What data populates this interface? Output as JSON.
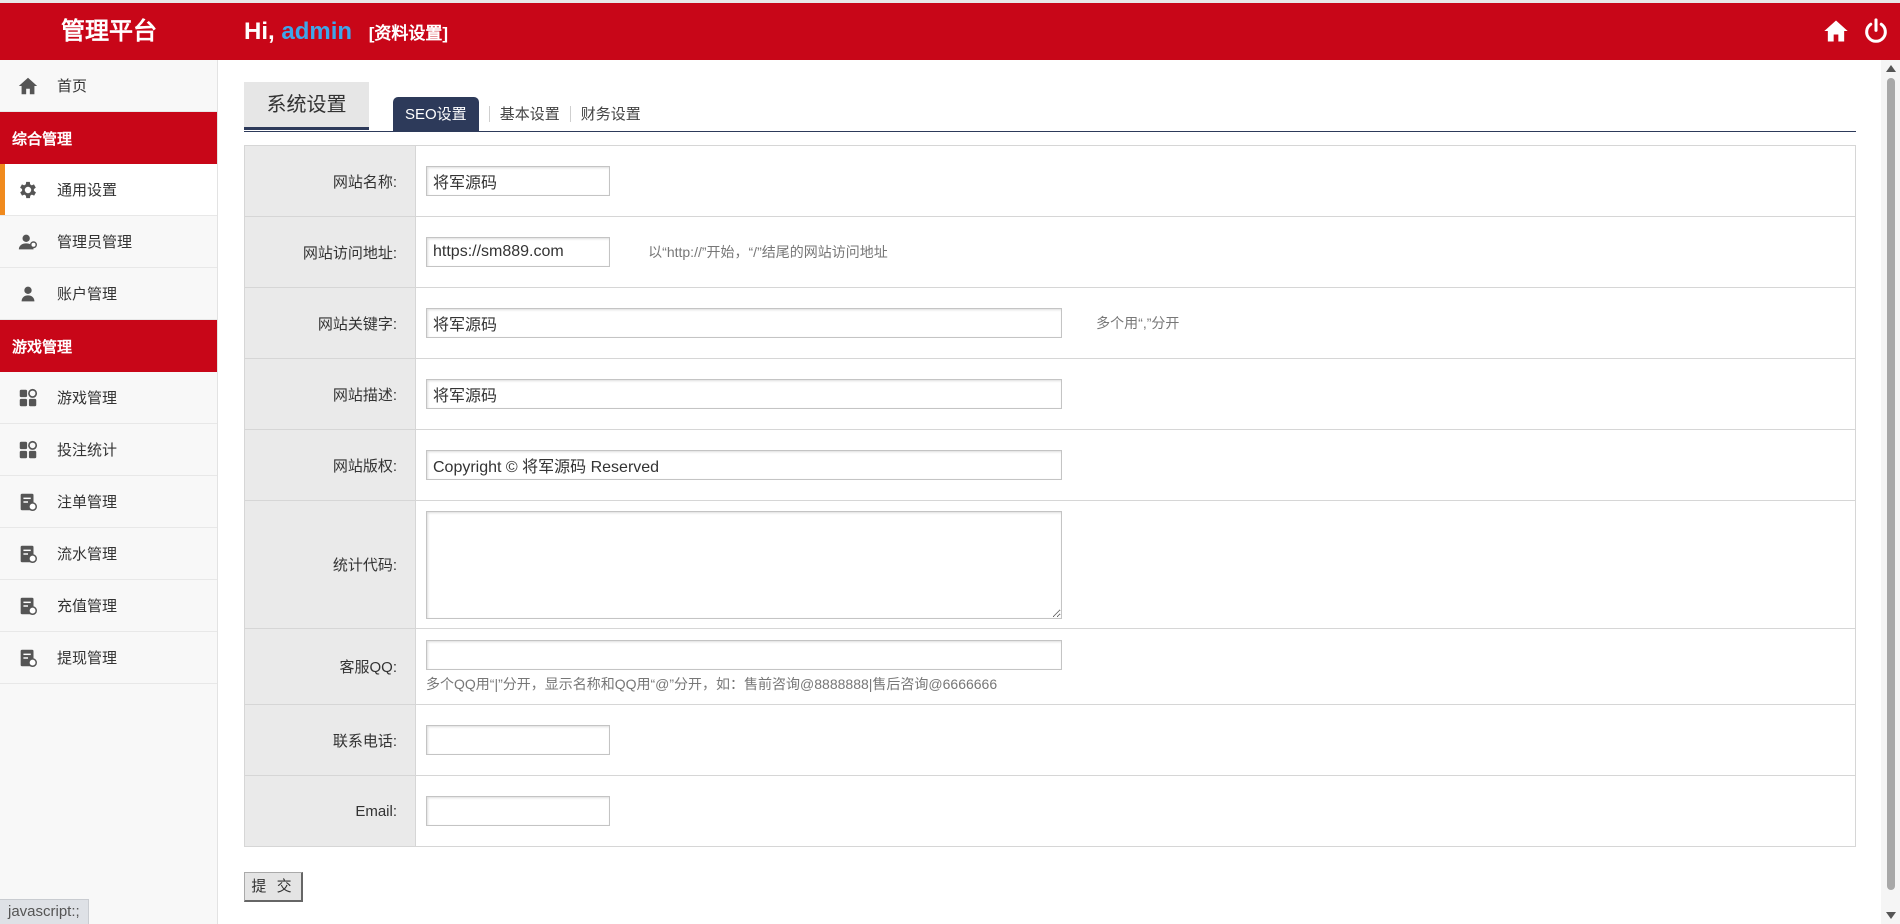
{
  "header": {
    "logo": "管理平台",
    "greeting": "Hi,",
    "username": "admin",
    "page_label": "[资料设置]",
    "icons": [
      "home-icon",
      "power-icon"
    ]
  },
  "sidebar": {
    "home": {
      "label": "首页",
      "icon": "home-icon"
    },
    "groups": [
      {
        "title": "综合管理",
        "items": [
          {
            "label": "通用设置",
            "icon": "gear-icon",
            "active": true
          },
          {
            "label": "管理员管理",
            "icon": "users-icon"
          },
          {
            "label": "账户管理",
            "icon": "user-icon"
          }
        ]
      },
      {
        "title": "游戏管理",
        "items": [
          {
            "label": "游戏管理",
            "icon": "apps-icon"
          },
          {
            "label": "投注统计",
            "icon": "apps-icon"
          },
          {
            "label": "注单管理",
            "icon": "doc-icon"
          },
          {
            "label": "流水管理",
            "icon": "doc-icon"
          },
          {
            "label": "充值管理",
            "icon": "doc-icon"
          },
          {
            "label": "提现管理",
            "icon": "doc-icon"
          }
        ]
      }
    ]
  },
  "main": {
    "section_title": "系统设置",
    "tabs": [
      {
        "label": "SEO设置",
        "active": true
      },
      {
        "label": "基本设置"
      },
      {
        "label": "财务设置"
      }
    ],
    "fields": {
      "site_name": {
        "label": "网站名称:",
        "value": "将军源码"
      },
      "site_url": {
        "label": "网站访问地址:",
        "value": "https://sm889.com",
        "hint": "以“http://”开始，“/”结尾的网站访问地址"
      },
      "keywords": {
        "label": "网站关键字:",
        "value": "将军源码",
        "hint": "多个用“,”分开"
      },
      "description": {
        "label": "网站描述:",
        "value": "将军源码"
      },
      "copyright": {
        "label": "网站版权:",
        "value": "Copyright © 将军源码 Reserved"
      },
      "stats_code": {
        "label": "统计代码:",
        "value": ""
      },
      "qq": {
        "label": "客服QQ:",
        "value": "",
        "hint": "多个QQ用“|”分开，显示名称和QQ用“@”分开，如：售前咨询@8888888|售后咨询@6666666"
      },
      "phone": {
        "label": "联系电话:",
        "value": ""
      },
      "email": {
        "label": "Email:",
        "value": ""
      }
    },
    "submit_label": "提 交"
  },
  "statusbar": {
    "text": "javascript:;"
  },
  "colors": {
    "brand": "#c80618",
    "accent_tab": "#2d3a5a",
    "active_marker": "#f08a1d",
    "username": "#3ea6ea"
  }
}
